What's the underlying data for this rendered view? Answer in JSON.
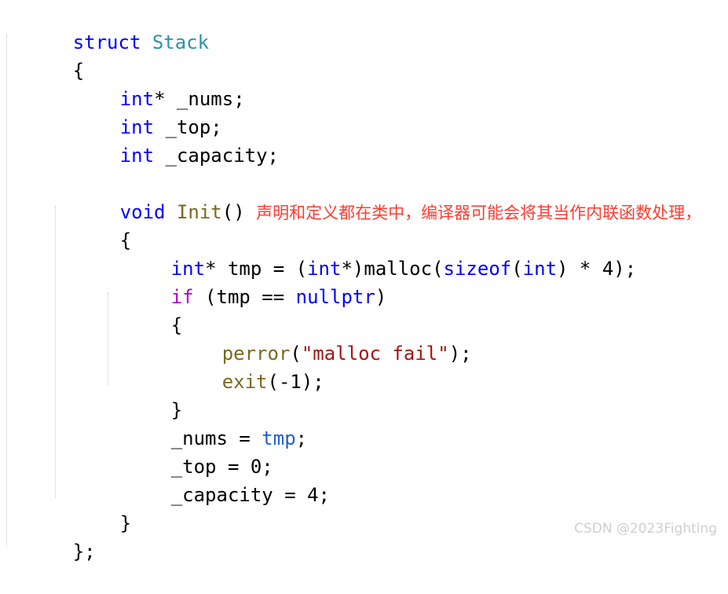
{
  "editor": {
    "background_color": "#ffffff",
    "font_size_px": 24,
    "line_height_px": 36,
    "indent_guides": [
      8,
      70,
      137
    ]
  },
  "colors": {
    "keyword": "#0000FF",
    "type_name": "#2B91AF",
    "control_keyword": "#AF00DB",
    "function_name": "#7A6A1E",
    "string_literal": "#A31515",
    "variable_reference": "#1F5FD0",
    "plain_text": "#000000",
    "annotation_red": "#FF3B30",
    "watermark_gray": "#CFCFCF"
  },
  "code": {
    "language": "C++",
    "lines": {
      "l1": {
        "t1": "struct",
        "t2": " ",
        "t3": "Stack"
      },
      "l2": {
        "t1": "{"
      },
      "l3": {
        "t1": "int",
        "t2": "* _nums;"
      },
      "l4": {
        "t1": "int",
        "t2": " _top;"
      },
      "l5": {
        "t1": "int",
        "t2": " _capacity;"
      },
      "l6": {
        "t1": ""
      },
      "l7": {
        "t1": "void",
        "t2": " ",
        "t3": "Init",
        "t4": "() ",
        "t5": "声明和定义都在类中，编译器可能会将其当作内联函数处理，"
      },
      "l8": {
        "t1": "{"
      },
      "l9": {
        "t1": "int",
        "t2": "* tmp = (",
        "t3": "int",
        "t4": "*)malloc(",
        "t5": "sizeof",
        "t6": "(",
        "t7": "int",
        "t8": ") * 4);"
      },
      "l10": {
        "t1": "if",
        "t2": " (tmp == ",
        "t3": "nullptr",
        "t4": ")"
      },
      "l11": {
        "t1": "{"
      },
      "l12": {
        "t1": "perror",
        "t2": "(",
        "t3": "\"malloc fail\"",
        "t4": ");"
      },
      "l13": {
        "t1": "exit",
        "t2": "(-1);"
      },
      "l14": {
        "t1": "}"
      },
      "l15": {
        "t1": "_nums = ",
        "t2": "tmp",
        "t3": ";"
      },
      "l16": {
        "t1": "_top = 0;"
      },
      "l17": {
        "t1": "_capacity = 4;"
      },
      "l18": {
        "t1": "}"
      },
      "l19": {
        "t1": "};"
      }
    }
  },
  "watermark": {
    "text": "CSDN @2023Fighting"
  }
}
